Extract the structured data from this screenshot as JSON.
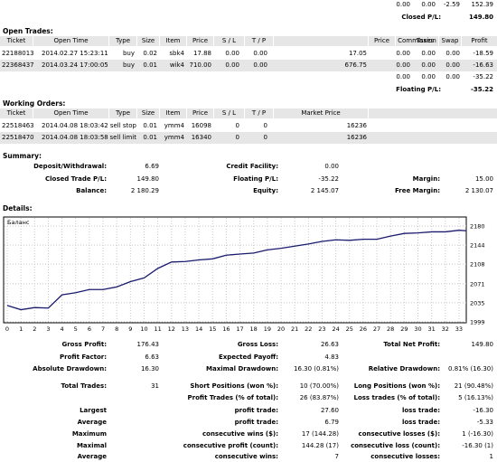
{
  "top_totals": {
    "row1": [
      "0.00",
      "0.00",
      "-2.59",
      "152.39"
    ],
    "closed_label": "Closed P/L:",
    "closed_value": "149.80"
  },
  "open_trades": {
    "title": "Open Trades:",
    "headers": [
      "Ticket",
      "Open Time",
      "Type",
      "Size",
      "Item",
      "Price",
      "S / L",
      "T / P",
      "Price",
      "Commission",
      "Taxes",
      "Swap",
      "Profit"
    ],
    "rows": [
      [
        "22188013",
        "2014.02.27 15:23:11",
        "buy",
        "0.02",
        "sbk4",
        "17.88",
        "0.00",
        "0.00",
        "17.05",
        "0.00",
        "0.00",
        "0.00",
        "-18.59"
      ],
      [
        "22368437",
        "2014.03.24 17:00:05",
        "buy",
        "0.01",
        "wik4",
        "710.00",
        "0.00",
        "0.00",
        "676.75",
        "0.00",
        "0.00",
        "0.00",
        "-16.63"
      ]
    ],
    "totals": [
      "0.00",
      "0.00",
      "0.00",
      "-35.22"
    ],
    "floating_label": "Floating P/L:",
    "floating_value": "-35.22"
  },
  "working_orders": {
    "title": "Working Orders:",
    "headers": [
      "Ticket",
      "Open Time",
      "Type",
      "Size",
      "Item",
      "Price",
      "S / L",
      "T / P",
      "Market Price"
    ],
    "rows": [
      [
        "22518463",
        "2014.04.08 18:03:42",
        "sell stop",
        "0.01",
        "ymm4",
        "16098",
        "0",
        "0",
        "16236"
      ],
      [
        "22518470",
        "2014.04.08 18:03:58",
        "sell limit",
        "0.01",
        "ymm4",
        "16340",
        "0",
        "0",
        "16236"
      ]
    ]
  },
  "summary": {
    "title": "Summary:",
    "deposit_label": "Deposit/Withdrawal:",
    "deposit_value": "6.69",
    "credit_label": "Credit Facility:",
    "credit_value": "0.00",
    "closed_label": "Closed Trade P/L:",
    "closed_value": "149.80",
    "floating_label": "Floating P/L:",
    "floating_value": "-35.22",
    "margin_label": "Margin:",
    "margin_value": "15.00",
    "balance_label": "Balance:",
    "balance_value": "2 180.29",
    "equity_label": "Equity:",
    "equity_value": "2 145.07",
    "free_margin_label": "Free Margin:",
    "free_margin_value": "2 130.07"
  },
  "details": {
    "title": "Details:"
  },
  "chart_data": {
    "type": "line",
    "title": "Баланс",
    "x": [
      0,
      1,
      2,
      3,
      4,
      5,
      6,
      7,
      8,
      9,
      10,
      11,
      12,
      13,
      14,
      15,
      16,
      17,
      18,
      19,
      20,
      21,
      22,
      23,
      24,
      25,
      26,
      27,
      28,
      29,
      30,
      31,
      32,
      33,
      34
    ],
    "values": [
      2030,
      2022,
      2026,
      2025,
      2050,
      2054,
      2060,
      2060,
      2065,
      2075,
      2082,
      2100,
      2112,
      2113,
      2116,
      2118,
      2125,
      2127,
      2129,
      2135,
      2138,
      2142,
      2146,
      2151,
      2154,
      2153,
      2155,
      2155,
      2161,
      2166,
      2167,
      2169,
      2169,
      2172,
      2171
    ],
    "x_ticks": [
      "0",
      "1",
      "2",
      "3",
      "4",
      "5",
      "6",
      "7",
      "8",
      "9",
      "10",
      "11",
      "12",
      "13",
      "14",
      "15",
      "16",
      "17",
      "18",
      "19",
      "20",
      "21",
      "22",
      "23",
      "24",
      "25",
      "26",
      "27",
      "28",
      "29",
      "30",
      "31",
      "32",
      "33"
    ],
    "y_ticks": [
      "2180",
      "2144",
      "2108",
      "2071",
      "2035",
      "1999"
    ],
    "ylim": [
      1999,
      2180
    ],
    "line_color": "#1a1a6e",
    "grid": true
  },
  "stats": {
    "gross_profit_label": "Gross Profit:",
    "gross_profit_value": "176.43",
    "gross_loss_label": "Gross Loss:",
    "gross_loss_value": "26.63",
    "net_profit_label": "Total Net Profit:",
    "net_profit_value": "149.80",
    "profit_factor_label": "Profit Factor:",
    "profit_factor_value": "6.63",
    "expected_payoff_label": "Expected Payoff:",
    "expected_payoff_value": "4.83",
    "abs_dd_label": "Absolute Drawdown:",
    "abs_dd_value": "16.30",
    "max_dd_label": "Maximal Drawdown:",
    "max_dd_value": "16.30 (0.81%)",
    "rel_dd_label": "Relative Drawdown:",
    "rel_dd_value": "0.81% (16.30)",
    "total_trades_label": "Total Trades:",
    "total_trades_value": "31",
    "short_label": "Short Positions (won %):",
    "short_value": "10 (70.00%)",
    "long_label": "Long Positions (won %):",
    "long_value": "21 (90.48%)",
    "profit_trades_label": "Profit Trades (% of total):",
    "profit_trades_value": "26 (83.87%)",
    "loss_trades_label": "Loss trades (% of total):",
    "loss_trades_value": "5 (16.13%)",
    "largest_label": "Largest",
    "largest_profit_label": "profit trade:",
    "largest_profit_value": "27.60",
    "largest_loss_label": "loss trade:",
    "largest_loss_value": "-16.30",
    "average_label": "Average",
    "average_profit_label": "profit trade:",
    "average_profit_value": "6.79",
    "average_loss_label": "loss trade:",
    "average_loss_value": "-5.33",
    "maximum_label": "Maximum",
    "max_cons_wins_label": "consecutive wins ($):",
    "max_cons_wins_value": "17 (144.28)",
    "max_cons_losses_label": "consecutive losses ($):",
    "max_cons_losses_value": "1 (-16.30)",
    "maximal_label": "Maximal",
    "maximal_profit_label": "consecutive profit (count):",
    "maximal_profit_value": "144.28 (17)",
    "maximal_loss_label": "consecutive loss (count):",
    "maximal_loss_value": "-16.30 (1)",
    "average2_label": "Average",
    "avg_cons_wins_label": "consecutive wins:",
    "avg_cons_wins_value": "7",
    "avg_cons_losses_label": "consecutive losses:",
    "avg_cons_losses_value": "1"
  }
}
